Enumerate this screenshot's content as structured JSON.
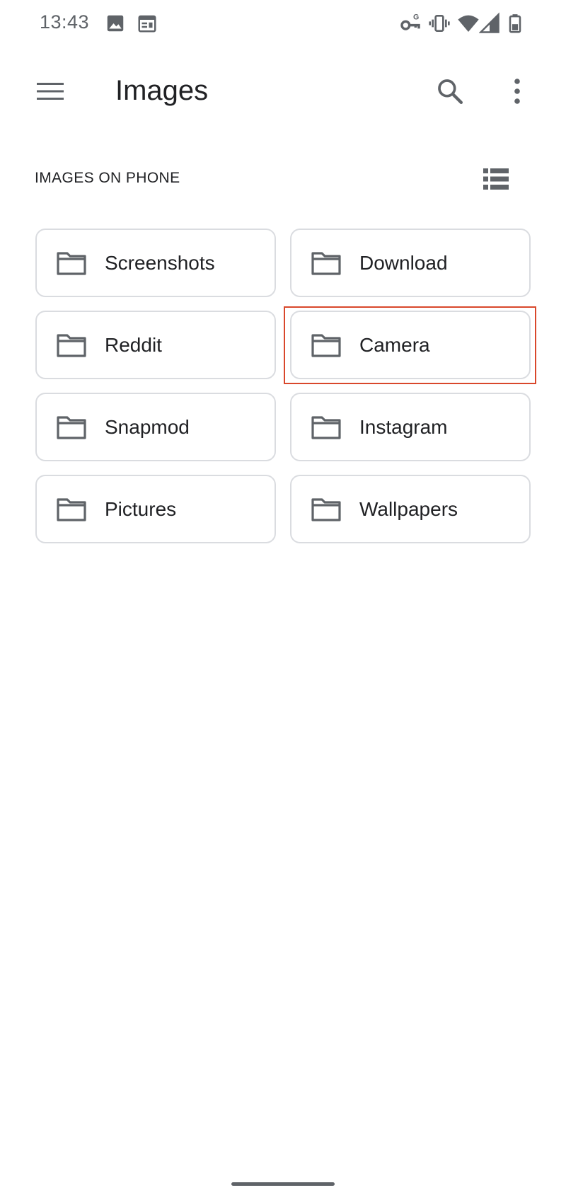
{
  "status_bar": {
    "time": "13:43",
    "left_icons": [
      "image-icon",
      "calendar-icon"
    ],
    "right_icons": [
      "vpn-key-icon",
      "vibrate-icon",
      "wifi-icon",
      "cell-signal-icon",
      "battery-icon"
    ]
  },
  "app_bar": {
    "title": "Images",
    "icons": [
      "menu-icon",
      "search-icon",
      "more-vert-icon"
    ]
  },
  "section": {
    "header": "IMAGES ON PHONE",
    "view_toggle_icon": "list-view-icon"
  },
  "folders": [
    {
      "name": "Screenshots"
    },
    {
      "name": "Download"
    },
    {
      "name": "Reddit"
    },
    {
      "name": "Camera"
    },
    {
      "name": "Snapmod"
    },
    {
      "name": "Instagram"
    },
    {
      "name": "Pictures"
    },
    {
      "name": "Wallpapers"
    }
  ],
  "highlighted_folder": "Camera",
  "colors": {
    "text_primary": "#202124",
    "icon_gray": "#5f6368",
    "card_border": "#dadce0",
    "highlight": "#d9472b",
    "background": "#ffffff"
  }
}
